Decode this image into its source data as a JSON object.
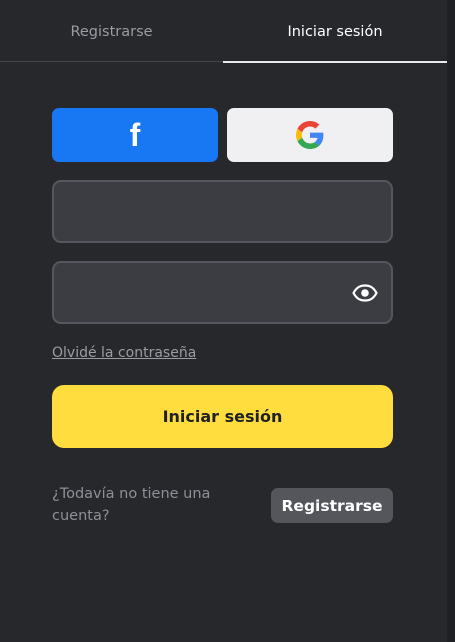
{
  "tabs": [
    {
      "label": "Registrarse",
      "active": false
    },
    {
      "label": "Iniciar sesión",
      "active": true
    }
  ],
  "social": {
    "facebook_icon": "f",
    "facebook_color": "#1877f2",
    "google_icon": "google-g-icon"
  },
  "form": {
    "username_value": "",
    "password_value": "",
    "forgot_link": "Olvidé la contraseña",
    "submit_label": "Iniciar sesión",
    "submit_color": "#ffdd3f"
  },
  "footer": {
    "question": "¿Todavía no tiene una cuenta?",
    "register_label": "Registrarse"
  }
}
